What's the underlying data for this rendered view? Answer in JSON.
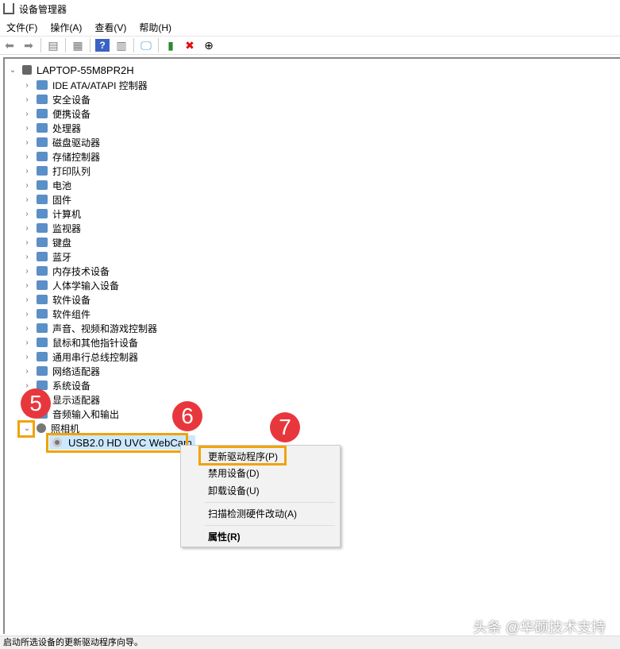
{
  "title": "设备管理器",
  "menu": [
    "文件(F)",
    "操作(A)",
    "查看(V)",
    "帮助(H)"
  ],
  "toolbar": [
    "back-icon",
    "forward-icon",
    "show-hide-tree-icon",
    "properties-icon",
    "help-icon",
    "action-pane-icon",
    "scan-monitor-icon",
    "update-driver-icon",
    "uninstall-icon",
    "download-icon"
  ],
  "tree": {
    "root": "LAPTOP-55M8PR2H",
    "items": [
      "IDE ATA/ATAPI 控制器",
      "安全设备",
      "便携设备",
      "处理器",
      "磁盘驱动器",
      "存储控制器",
      "打印队列",
      "电池",
      "固件",
      "计算机",
      "监视器",
      "键盘",
      "蓝牙",
      "内存技术设备",
      "人体学输入设备",
      "软件设备",
      "软件组件",
      "声音、视频和游戏控制器",
      "鼠标和其他指针设备",
      "通用串行总线控制器",
      "网络适配器",
      "系统设备",
      "显示适配器",
      "音频输入和输出",
      "照相机"
    ],
    "child": "USB2.0 HD UVC WebCam"
  },
  "context_menu": {
    "update": "更新驱动程序(P)",
    "disable": "禁用设备(D)",
    "uninstall": "卸载设备(U)",
    "scan": "扫描检测硬件改动(A)",
    "properties": "属性(R)"
  },
  "badges": [
    "5",
    "6",
    "7"
  ],
  "status": "启动所选设备的更新驱动程序向导。",
  "watermark": "头条 @华硕技术支持",
  "colors": {
    "highlight": "#f0a30a",
    "badge": "#e8373c"
  }
}
